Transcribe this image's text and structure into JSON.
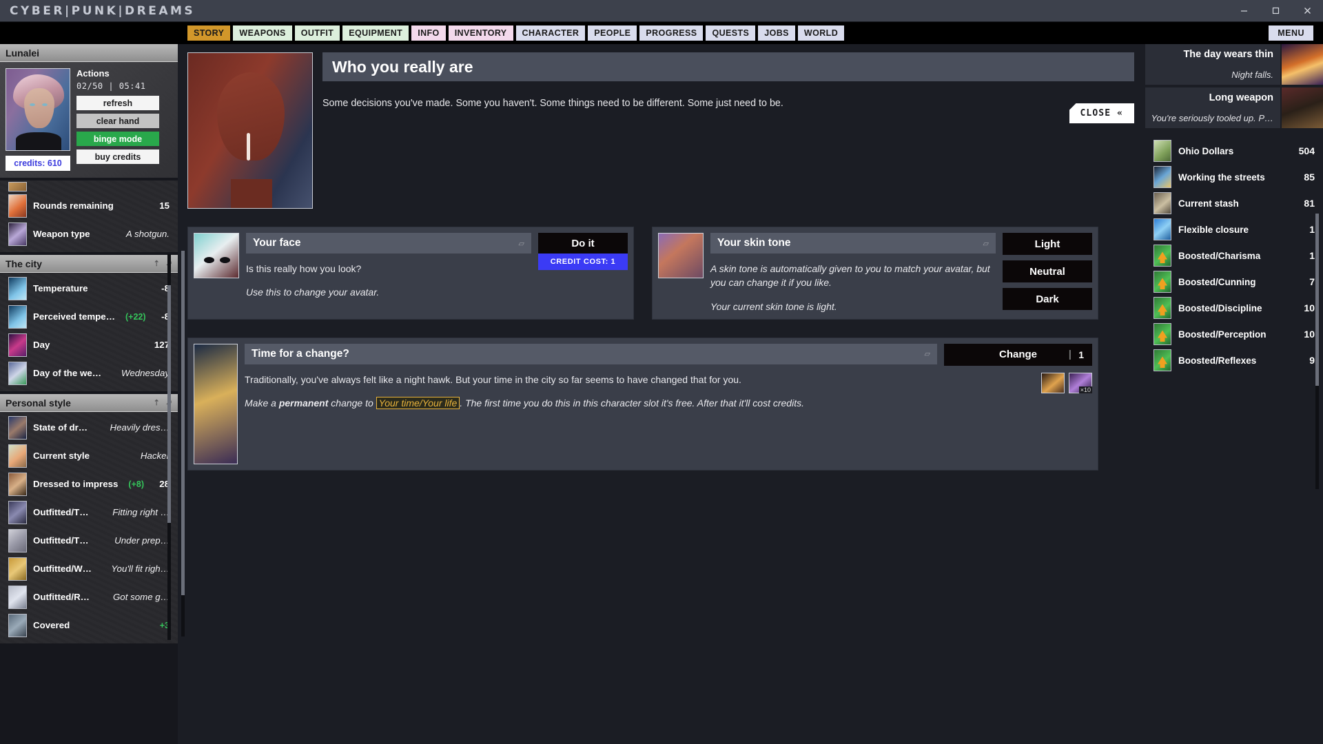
{
  "window": {
    "brand": "CYBER|PUNK|DREAMS",
    "minimize": "minimize-icon",
    "maximize": "maximize-icon",
    "close": "close-icon"
  },
  "nav": {
    "tabs": [
      {
        "label": "STORY",
        "style": "amber"
      },
      {
        "label": "WEAPONS",
        "style": "green"
      },
      {
        "label": "OUTFIT",
        "style": "green"
      },
      {
        "label": "EQUIPMENT",
        "style": "green"
      },
      {
        "label": "INFO",
        "style": "pink"
      },
      {
        "label": "INVENTORY",
        "style": "pink"
      },
      {
        "label": "CHARACTER",
        "style": "blue"
      },
      {
        "label": "PEOPLE",
        "style": "blue"
      },
      {
        "label": "PROGRESS",
        "style": "blue"
      },
      {
        "label": "QUESTS",
        "style": "blue"
      },
      {
        "label": "JOBS",
        "style": "blue"
      },
      {
        "label": "WORLD",
        "style": "blue"
      }
    ],
    "menu_label": "MENU"
  },
  "sidebar_left": {
    "character": {
      "name": "Lunalei",
      "actions_title": "Actions",
      "actions_count": "02/50  |  05:41",
      "credits_label": "credits: 610",
      "buttons": [
        {
          "label": "refresh",
          "style": "light"
        },
        {
          "label": "clear hand",
          "style": "grey"
        },
        {
          "label": "binge mode",
          "style": "green"
        },
        {
          "label": "buy credits",
          "style": "light"
        }
      ]
    },
    "weapon_rows": [
      {
        "label": "Rounds remaining",
        "value": "15",
        "bonus": "",
        "italic": false,
        "icon": "rounds-icon"
      },
      {
        "label": "Weapon type",
        "value": "A shotgun.",
        "bonus": "",
        "italic": true,
        "icon": "weapon-icon"
      }
    ],
    "sections": [
      {
        "title": "The city",
        "rows": [
          {
            "label": "Temperature",
            "value": "-8",
            "bonus": "",
            "italic": false,
            "icon": "temperature-icon"
          },
          {
            "label": "Perceived tempe…",
            "value": "-8",
            "bonus": "(+22)",
            "italic": false,
            "icon": "perceived-temperature-icon"
          },
          {
            "label": "Day",
            "value": "127",
            "bonus": "",
            "italic": false,
            "icon": "day-icon"
          },
          {
            "label": "Day of the we…",
            "value": "Wednesday",
            "bonus": "",
            "italic": true,
            "icon": "day-of-week-icon"
          }
        ]
      },
      {
        "title": "Personal style",
        "rows": [
          {
            "label": "State of dr…",
            "value": "Heavily dres…",
            "bonus": "",
            "italic": true,
            "icon": "state-of-dress-icon"
          },
          {
            "label": "Current style",
            "value": "Hacker",
            "bonus": "",
            "italic": true,
            "icon": "current-style-icon"
          },
          {
            "label": "Dressed to impress",
            "value": "28",
            "bonus": "(+8)",
            "italic": false,
            "icon": "dressed-to-impress-icon"
          },
          {
            "label": "Outfitted/T…",
            "value": "Fitting right …",
            "bonus": "",
            "italic": true,
            "icon": "outfitted-t-icon"
          },
          {
            "label": "Outfitted/T…",
            "value": "Under prep…",
            "bonus": "",
            "italic": true,
            "icon": "outfitted-t2-icon"
          },
          {
            "label": "Outfitted/W…",
            "value": "You'll fit righ…",
            "bonus": "",
            "italic": true,
            "icon": "outfitted-w-icon"
          },
          {
            "label": "Outfitted/R…",
            "value": "Got some g…",
            "bonus": "",
            "italic": true,
            "icon": "outfitted-r-icon"
          },
          {
            "label": "Covered",
            "value": "",
            "bonus": "+3",
            "italic": false,
            "icon": "covered-icon"
          }
        ]
      }
    ]
  },
  "main": {
    "hero": {
      "title": "Who you really are",
      "subtitle": "Some decisions you've made. Some you haven't. Some things need to be different. Some just need to be.",
      "close_label": "CLOSE «",
      "image": "avatar-portrait"
    },
    "cards": [
      {
        "title": "Your face",
        "text": "Is this really how you look?",
        "text2": "Use this to change your avatar.",
        "thumb": "mask-thumbnail",
        "action_label": "Do it",
        "cost_label": "CREDIT COST: 1"
      },
      {
        "title": "Your skin tone",
        "text": "A skin tone is automatically given to you to match your avatar, but you can change it if you like.",
        "text2": "Your current skin tone is light.",
        "text2_bold": "light",
        "thumb": "torso-thumbnail",
        "options": [
          "Light",
          "Neutral",
          "Dark"
        ]
      }
    ],
    "wide_card": {
      "title": "Time for a change?",
      "text": "Traditionally, you've always felt like a night hawk. But your time in the city so far seems to have changed that for you.",
      "text2_prefix": "Make a ",
      "text2_bold": "permanent",
      "text2_mid": " change to ",
      "text2_highlight": "Your time/Your life",
      "text2_suffix": ". The first time you do this in this character slot it's free. After that it'll cost credits.",
      "thumb": "city-lights-thumbnail",
      "action_label": "Change",
      "action_count": "1",
      "mini_count": "×10"
    }
  },
  "sidebar_right": {
    "events": [
      {
        "title": "The day wears thin",
        "desc": "Night falls.",
        "icon": "city-night-icon"
      },
      {
        "title": "Long weapon",
        "desc": "You're seriously tooled up. P…",
        "icon": "hooded-figure-icon"
      }
    ],
    "stats": [
      {
        "label": "Ohio Dollars",
        "value": "504",
        "icon": "money-icon"
      },
      {
        "label": "Working the streets",
        "value": "85",
        "icon": "street-icon"
      },
      {
        "label": "Current stash",
        "value": "81",
        "icon": "stash-icon"
      },
      {
        "label": "Flexible closure",
        "value": "1",
        "icon": "flexible-icon"
      },
      {
        "label": "Boosted/Charisma",
        "value": "1",
        "icon": "boost-up-icon"
      },
      {
        "label": "Boosted/Cunning",
        "value": "7",
        "icon": "boost-up-icon"
      },
      {
        "label": "Boosted/Discipline",
        "value": "10",
        "icon": "boost-up-icon"
      },
      {
        "label": "Boosted/Perception",
        "value": "10",
        "icon": "boost-up-icon"
      },
      {
        "label": "Boosted/Reflexes",
        "value": "9",
        "icon": "boost-up-icon"
      }
    ]
  },
  "colors": {
    "accent_amber": "#d2972a",
    "accent_blue": "#3b3bf5",
    "accent_green": "#29a84b",
    "bonus_green": "#35c65b",
    "credits_blue": "#3b3bdd",
    "highlight_amber": "#e8b33c"
  }
}
